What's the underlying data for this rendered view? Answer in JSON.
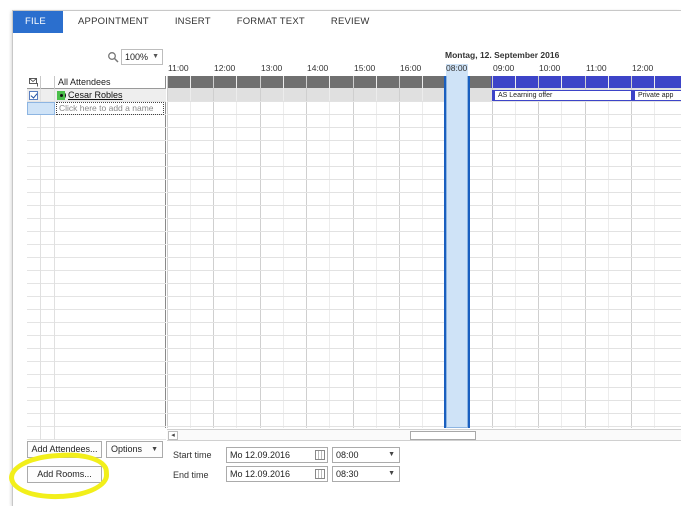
{
  "ribbon": {
    "tabs": [
      "FILE",
      "APPOINTMENT",
      "INSERT",
      "FORMAT TEXT",
      "REVIEW"
    ]
  },
  "zoom": {
    "value": "100%"
  },
  "attendees": {
    "header": "All Attendees",
    "list": [
      {
        "name": "Cesar Robles",
        "status_color": "#4bbf4b",
        "checked": true
      }
    ],
    "add_placeholder": "Click here to add a name"
  },
  "timeline": {
    "date": "Montag, 12. September 2016",
    "hours": [
      "11:00",
      "12:00",
      "13:00",
      "14:00",
      "15:00",
      "16:00",
      "08:00",
      "09:00",
      "10:00",
      "11:00",
      "12:00"
    ],
    "appointments": [
      {
        "label": "AS Learning offer"
      },
      {
        "label": "Private app"
      }
    ],
    "busy_color": "#3d44c8",
    "selection_color": "#1a5fbf"
  },
  "buttons": {
    "add_attendees": "Add Attendees...",
    "options": "Options",
    "add_rooms": "Add Rooms..."
  },
  "schedule": {
    "start_label": "Start time",
    "start_date": "Mo 12.09.2016",
    "start_time": "08:00",
    "end_label": "End time",
    "end_date": "Mo 12.09.2016",
    "end_time": "08:30"
  },
  "colors": {
    "accent": "#2b6fce",
    "highlight": "#f2ef1a"
  }
}
